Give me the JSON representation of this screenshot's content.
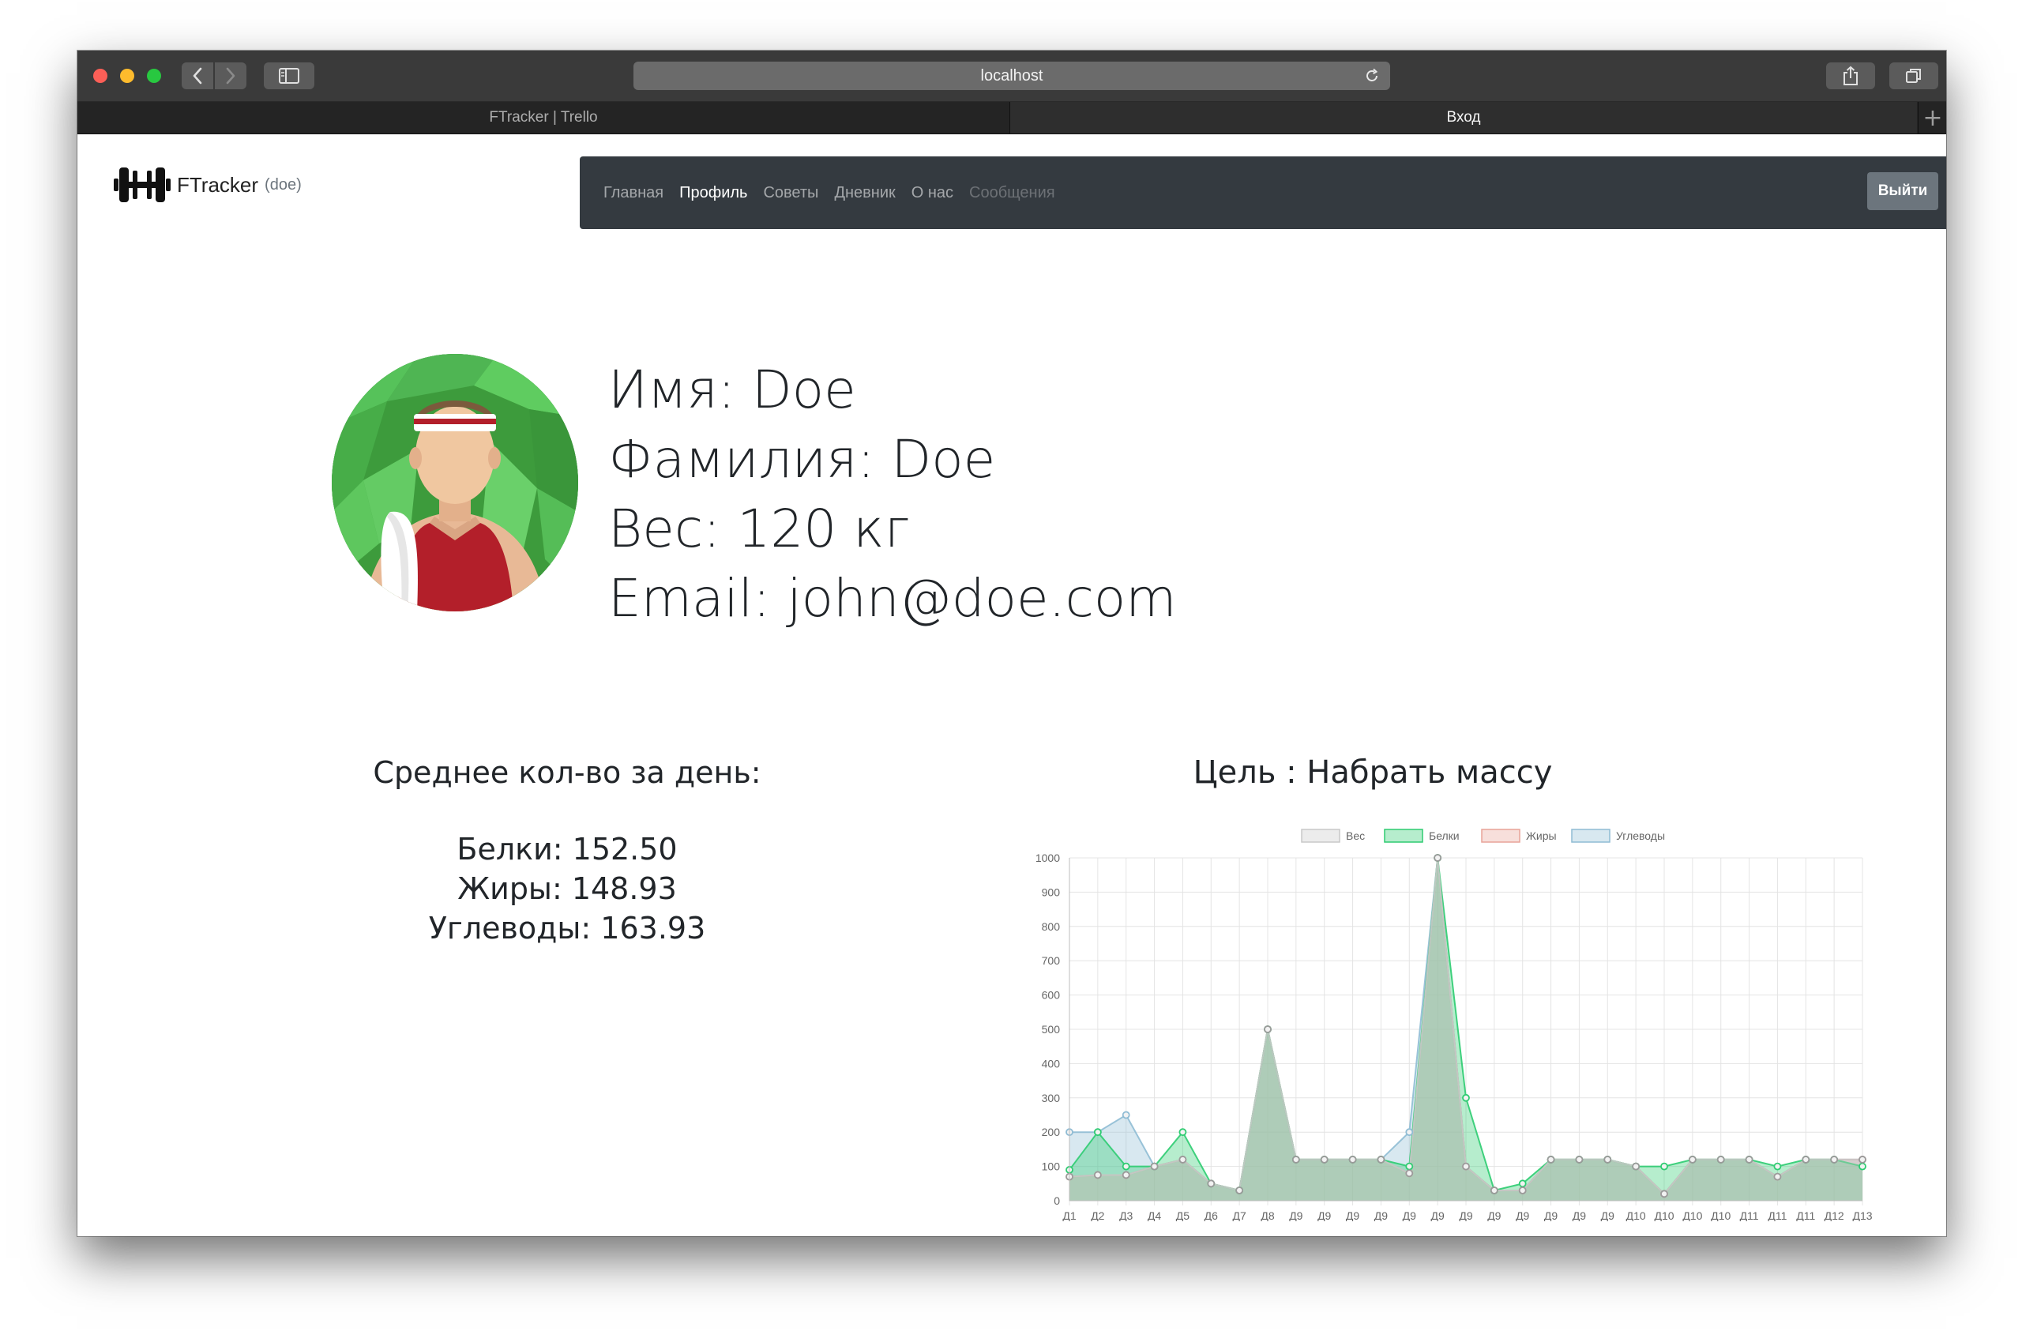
{
  "browser": {
    "url": "localhost",
    "tabs": [
      {
        "label": "FTracker | Trello",
        "active": false
      },
      {
        "label": "Вход",
        "active": true
      }
    ]
  },
  "brand": {
    "name": "FTracker",
    "user": "(doe)"
  },
  "nav": {
    "items": [
      {
        "label": "Главная",
        "state": "normal"
      },
      {
        "label": "Профиль",
        "state": "active"
      },
      {
        "label": "Советы",
        "state": "normal"
      },
      {
        "label": "Дневник",
        "state": "normal"
      },
      {
        "label": "О нас",
        "state": "normal"
      },
      {
        "label": "Сообщения",
        "state": "disabled"
      }
    ],
    "logout_label": "Выйти"
  },
  "profile": {
    "name_line": "Имя: Doe",
    "surname_line": "Фамилия: Doe",
    "weight_line": "Вес: 120 кг",
    "email_line": "Email: john@doe.com"
  },
  "averages": {
    "title": "Среднее кол-во за день:",
    "protein_line": "Белки: 152.50",
    "fat_line": "Жиры: 148.93",
    "carbs_line": "Углеводы: 163.93"
  },
  "goal": {
    "title": "Цель : Набрать массу"
  },
  "colors": {
    "navbar": "#343a40",
    "logout_button": "#6c757d",
    "series_weight": "#c8c8c8",
    "series_protein": "#2ecc71",
    "series_fat": "#e8a398",
    "series_carbs": "#8fbcd4"
  },
  "chart_data": {
    "type": "area",
    "title": "",
    "xlabel": "",
    "ylabel": "",
    "ylim": [
      0,
      1000
    ],
    "yticks": [
      0,
      100,
      200,
      300,
      400,
      500,
      600,
      700,
      800,
      900,
      1000
    ],
    "grid": true,
    "legend_position": "top",
    "categories": [
      "Д1",
      "Д2",
      "Д3",
      "Д4",
      "Д5",
      "Д6",
      "Д7",
      "Д8",
      "Д9",
      "Д9",
      "Д9",
      "Д9",
      "Д9",
      "Д9",
      "Д9",
      "Д9",
      "Д9",
      "Д9",
      "Д9",
      "Д9",
      "Д10",
      "Д10",
      "Д10",
      "Д10",
      "Д11",
      "Д11",
      "Д11",
      "Д12",
      "Д13"
    ],
    "series": [
      {
        "name": "Вес",
        "color": "#c8c8c8",
        "values": [
          70,
          75,
          75,
          100,
          120,
          50,
          30,
          500,
          120,
          120,
          120,
          120,
          80,
          1000,
          100,
          30,
          30,
          120,
          120,
          120,
          100,
          20,
          120,
          120,
          120,
          70,
          120,
          120,
          120
        ]
      },
      {
        "name": "Белки",
        "color": "#2ecc71",
        "values": [
          90,
          200,
          100,
          100,
          200,
          50,
          30,
          500,
          120,
          120,
          120,
          120,
          100,
          1000,
          300,
          30,
          50,
          120,
          120,
          120,
          100,
          100,
          120,
          120,
          120,
          100,
          120,
          120,
          100
        ]
      },
      {
        "name": "Жиры",
        "color": "#e8a398",
        "values": [
          70,
          75,
          75,
          100,
          120,
          50,
          30,
          500,
          120,
          120,
          120,
          120,
          80,
          1000,
          100,
          30,
          30,
          120,
          120,
          120,
          100,
          20,
          120,
          120,
          120,
          70,
          120,
          120,
          120
        ]
      },
      {
        "name": "Углеводы",
        "color": "#8fbcd4",
        "values": [
          200,
          200,
          250,
          100,
          120,
          50,
          30,
          500,
          120,
          120,
          120,
          120,
          200,
          1000,
          100,
          30,
          30,
          120,
          120,
          120,
          100,
          20,
          120,
          120,
          120,
          70,
          120,
          120,
          120
        ]
      }
    ]
  }
}
